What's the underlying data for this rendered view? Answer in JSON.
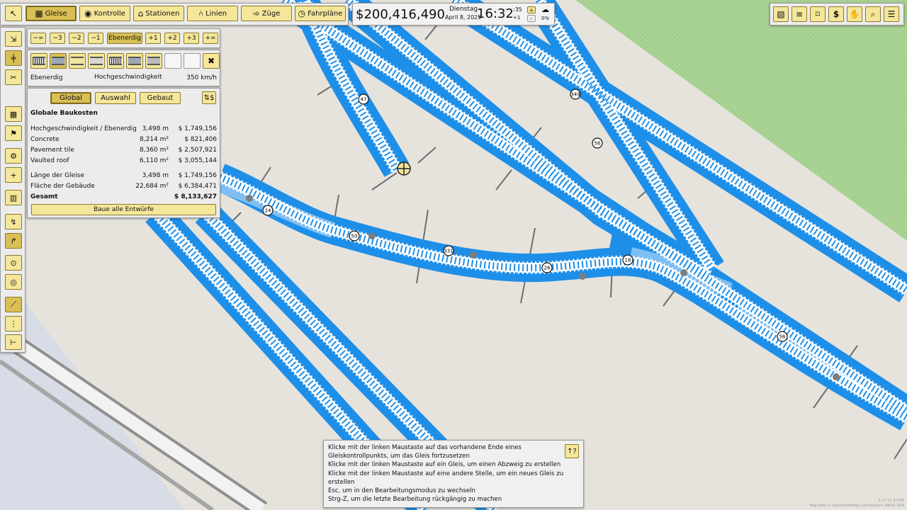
{
  "toolbar": {
    "tabs": [
      {
        "label": "Gleise",
        "icon": "rails-icon",
        "glyph": "▦"
      },
      {
        "label": "Kontrolle",
        "icon": "signal-icon",
        "glyph": "◉"
      },
      {
        "label": "Stationen",
        "icon": "station-icon",
        "glyph": "⌂"
      },
      {
        "label": "Linien",
        "icon": "lines-icon",
        "glyph": "⑃"
      },
      {
        "label": "Züge",
        "icon": "train-icon",
        "glyph": "➾"
      },
      {
        "label": "Fahrpläne",
        "icon": "timetable-icon",
        "glyph": "◷"
      }
    ],
    "active_tab": "Gleise"
  },
  "status": {
    "money": "$200,416,490",
    "weekday": "Dienstag",
    "date": "April 8, 2025",
    "time": "16:32",
    "seconds": ":35",
    "speed": "+1",
    "speed_up": "+",
    "speed_down": "-",
    "percent": "0%"
  },
  "levels": {
    "items": [
      "−∞",
      "−3",
      "−2",
      "−1",
      "Ebenerdig",
      "+1",
      "+2",
      "+3",
      "+∞"
    ],
    "active": "Ebenerdig"
  },
  "track": {
    "level_label": "Ebenerdig",
    "type_label": "Hochgeschwindigkeit",
    "speed_label": "350 km/h"
  },
  "cost": {
    "tabs": [
      "Global",
      "Auswahl",
      "Gebaut"
    ],
    "active_tab": "Global",
    "title": "Globale Baukosten",
    "rows": [
      {
        "name": "Hochgeschwindigkeit / Ebenerdig",
        "qty": "3,498 m",
        "cost": "$ 1,749,156"
      },
      {
        "name": "Concrete",
        "qty": "8,214 m²",
        "cost": "$ 821,406"
      },
      {
        "name": "Pavement tile",
        "qty": "8,360 m²",
        "cost": "$ 2,507,921"
      },
      {
        "name": "Vaulted roof",
        "qty": "6,110 m²",
        "cost": "$ 3,055,144"
      }
    ],
    "len_label": "Länge der Gleise",
    "len_qty": "3,498 m",
    "len_cost": "$ 1,749,156",
    "area_label": "Fläche der Gebäude",
    "area_qty": "22,684 m²",
    "area_cost": "$ 6,384,471",
    "total_label": "Gesamt",
    "total_cost": "$ 8,133,627",
    "build_button": "Baue alle Entwürfe"
  },
  "help": {
    "lines": [
      "Klicke mit der linken Maustaste auf das vorhandene Ende eines",
      "Gleiskontrollpunkts, um das Gleis fortzusetzen",
      "Klicke mit der linken Maustaste auf ein Gleis, um einen Abzweig zu erstellen",
      "Klicke mit der linken Maustaste auf eine andere Stelle, um ein neues Gleis zu",
      "erstellen",
      "Esc, um in den Bearbeitungsmodus zu wechseln",
      "Strg-Z, um die letzte Bearbeitung rückgängig zu machen"
    ]
  },
  "speed_markers": [
    "47",
    "349",
    "56",
    "24",
    "50",
    "331",
    "26",
    "18",
    "56"
  ],
  "map_credit": "Map data © OpenStreetMap Contributors, NASA, ESA",
  "version": "1.17.11.37159",
  "colors": {
    "track": "#1e8fe8",
    "accent": "#f5e79a",
    "active": "#d9bf55",
    "grass": "#a9d394",
    "ground": "#e6e3dc"
  }
}
